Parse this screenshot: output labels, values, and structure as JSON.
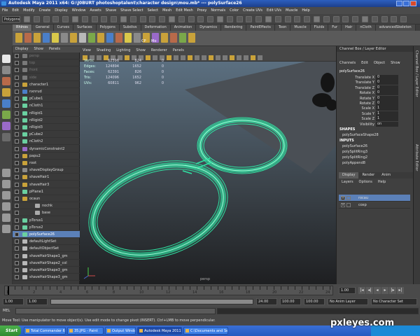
{
  "title": "Autodesk Maya 2011 x64: G:\\J0BURT photoshoptalent\\character design\\mou.mb* --- polySurface26",
  "menubar": [
    "File",
    "Edit",
    "Modify",
    "Create",
    "Display",
    "Window",
    "Assets",
    "Shave",
    "Shave Select",
    "Select",
    "Mesh",
    "Edit Mesh",
    "Proxy",
    "Normals",
    "Color",
    "Create UVs",
    "Edit UVs",
    "Muscle",
    "Help"
  ],
  "status_line": {
    "mode": "Polygons"
  },
  "shelf_tabs": [
    "Rhinos",
    "General",
    "Curves",
    "Surfaces",
    "Polygons",
    "Subdivs",
    "Deformation",
    "Animation",
    "Dynamics",
    "Rendering",
    "PaintEffects",
    "Toon",
    "Muscle",
    "Fluids",
    "Fur",
    "Hair",
    "nCloth",
    "advancedSkeleton"
  ],
  "shelf_labels": [
    "CP",
    "Mo"
  ],
  "outliner": {
    "menu": [
      "Display",
      "Show",
      "Panels"
    ],
    "items": [
      {
        "label": "persp",
        "dim": true
      },
      {
        "label": "top",
        "dim": true
      },
      {
        "label": "front",
        "dim": true
      },
      {
        "label": "side",
        "dim": true
      },
      {
        "label": "character1",
        "dim": false
      },
      {
        "label": "nxnrud",
        "dim": false
      },
      {
        "label": "pCube1",
        "dim": false
      },
      {
        "label": "nCloth1",
        "dim": false
      },
      {
        "label": "nRigid1",
        "dim": false
      },
      {
        "label": "nRigid2",
        "dim": false
      },
      {
        "label": "nRigid3",
        "dim": false
      },
      {
        "label": "pCube2",
        "dim": false
      },
      {
        "label": "nCloth2",
        "dim": false
      },
      {
        "label": "dynamicConstraint2",
        "dim": false
      },
      {
        "label": "papu2",
        "dim": false
      },
      {
        "label": "root",
        "dim": false
      },
      {
        "label": "shaveDisplayGroup",
        "dim": false
      },
      {
        "label": "shaveHair1",
        "dim": false
      },
      {
        "label": "shaveHair3",
        "dim": false
      },
      {
        "label": "pPlane1",
        "dim": false
      },
      {
        "label": "ocaun",
        "dim": false
      },
      {
        "label": "nochk",
        "dim": false
      },
      {
        "label": "base",
        "dim": false
      },
      {
        "label": "pTorus1",
        "dim": false
      },
      {
        "label": "pTorus2",
        "dim": false
      },
      {
        "label": "polySurface26",
        "dim": false,
        "selected": true
      },
      {
        "label": "defaultLightSet",
        "dim": false
      },
      {
        "label": "defaultObjectSet",
        "dim": false
      },
      {
        "label": "shaveHairShape1_gm",
        "dim": false
      },
      {
        "label": "shaveHairShape2_col",
        "dim": false
      },
      {
        "label": "shaveHairShape3_gm",
        "dim": false
      },
      {
        "label": "shaveHairShape3_gm",
        "dim": false
      }
    ]
  },
  "viewport": {
    "menu": [
      "View",
      "Shading",
      "Lighting",
      "Show",
      "Renderer",
      "Panels"
    ],
    "hud": [
      {
        "label": "Verts:",
        "a": "62596",
        "b": "824",
        "c": "0"
      },
      {
        "label": "Edges:",
        "a": "124894",
        "b": "1652",
        "c": "0"
      },
      {
        "label": "Faces:",
        "a": "62391",
        "b": "826",
        "c": "0"
      },
      {
        "label": "Tris:",
        "a": "124096",
        "b": "1652",
        "c": "0"
      },
      {
        "label": "UVs:",
        "a": "60811",
        "b": "962",
        "c": "0"
      }
    ],
    "camera_label": "persp"
  },
  "channel_box": {
    "header": "Channel Box / Layer Editor",
    "menu": [
      "Channels",
      "Edit",
      "Object",
      "Show"
    ],
    "object": "polySurface26",
    "attributes": [
      {
        "name": "Translate X",
        "value": "0"
      },
      {
        "name": "Translate Y",
        "value": "0"
      },
      {
        "name": "Translate Z",
        "value": "0"
      },
      {
        "name": "Rotate X",
        "value": "0"
      },
      {
        "name": "Rotate Y",
        "value": "0"
      },
      {
        "name": "Rotate Z",
        "value": "0"
      },
      {
        "name": "Scale X",
        "value": "1"
      },
      {
        "name": "Scale Y",
        "value": "1"
      },
      {
        "name": "Scale Z",
        "value": "1"
      },
      {
        "name": "Visibility",
        "value": "on"
      }
    ],
    "shapes_label": "SHAPES",
    "shape": "polySurfaceShape28",
    "inputs_label": "INPUTS",
    "inputs": [
      "polySurface26",
      "polySplitRing3",
      "polySplitRing2",
      "polyAppend8"
    ]
  },
  "side_tabs": [
    "Channel Box / Layer Editor",
    "Attribute Editor"
  ],
  "layer_editor": {
    "tabs": [
      "Display",
      "Render",
      "Anim"
    ],
    "menu": [
      "Layers",
      "Options",
      "Help"
    ],
    "layers": [
      {
        "vis": "V",
        "name": "rocau",
        "selected": true
      },
      {
        "vis": "V",
        "name": "coxp",
        "selected": false
      }
    ]
  },
  "time_slider": {
    "ticks": [
      "1",
      "2",
      "4",
      "6",
      "8",
      "10",
      "12",
      "14",
      "16",
      "18",
      "20",
      "22",
      "24"
    ],
    "current": "1.00"
  },
  "range_slider": {
    "start": "1.00",
    "inner_start": "1.00",
    "end_inner": "24.00",
    "end": "100.00",
    "end2": "100.00",
    "anim_layer": "No Anim Layer",
    "char_set": "No Character Set"
  },
  "cmd_label": "MEL",
  "help_line": "Move Tool: Use manipulator to move object(s). Use edit mode to change pivot (INSERT). Ctrl+LMB to move perpendicular.",
  "taskbar": {
    "start": "Start",
    "tasks": [
      {
        "label": "Total Commander 6.03 - ...",
        "active": false
      },
      {
        "label": "35.JPG - Paint",
        "active": false
      },
      {
        "label": "Output Window",
        "active": false
      },
      {
        "label": "Autodesk Maya 2011 ...",
        "active": true
      },
      {
        "label": "C:\\Documents and Settin...",
        "active": false
      }
    ]
  },
  "watermark": "pxleyes.com",
  "colors": {
    "wire": "#2fe3a3",
    "selection": "#5b80b8",
    "title": "#2d5fbf"
  }
}
